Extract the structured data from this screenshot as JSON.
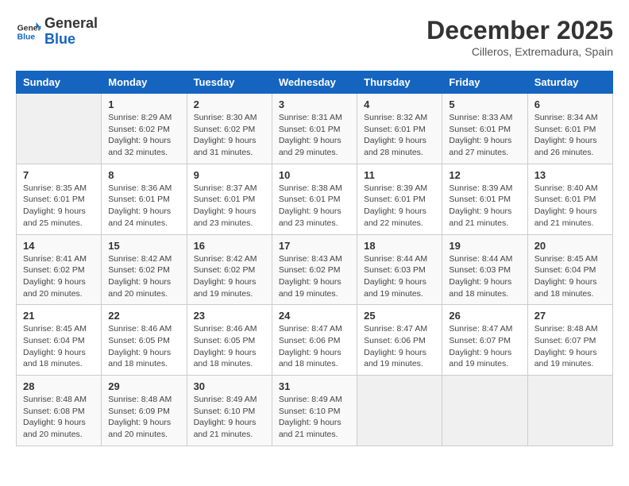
{
  "header": {
    "logo_general": "General",
    "logo_blue": "Blue",
    "month_title": "December 2025",
    "subtitle": "Cilleros, Extremadura, Spain"
  },
  "days_of_week": [
    "Sunday",
    "Monday",
    "Tuesday",
    "Wednesday",
    "Thursday",
    "Friday",
    "Saturday"
  ],
  "weeks": [
    [
      {
        "day": "",
        "info": ""
      },
      {
        "day": "1",
        "info": "Sunrise: 8:29 AM\nSunset: 6:02 PM\nDaylight: 9 hours\nand 32 minutes."
      },
      {
        "day": "2",
        "info": "Sunrise: 8:30 AM\nSunset: 6:02 PM\nDaylight: 9 hours\nand 31 minutes."
      },
      {
        "day": "3",
        "info": "Sunrise: 8:31 AM\nSunset: 6:01 PM\nDaylight: 9 hours\nand 29 minutes."
      },
      {
        "day": "4",
        "info": "Sunrise: 8:32 AM\nSunset: 6:01 PM\nDaylight: 9 hours\nand 28 minutes."
      },
      {
        "day": "5",
        "info": "Sunrise: 8:33 AM\nSunset: 6:01 PM\nDaylight: 9 hours\nand 27 minutes."
      },
      {
        "day": "6",
        "info": "Sunrise: 8:34 AM\nSunset: 6:01 PM\nDaylight: 9 hours\nand 26 minutes."
      }
    ],
    [
      {
        "day": "7",
        "info": "Sunrise: 8:35 AM\nSunset: 6:01 PM\nDaylight: 9 hours\nand 25 minutes."
      },
      {
        "day": "8",
        "info": "Sunrise: 8:36 AM\nSunset: 6:01 PM\nDaylight: 9 hours\nand 24 minutes."
      },
      {
        "day": "9",
        "info": "Sunrise: 8:37 AM\nSunset: 6:01 PM\nDaylight: 9 hours\nand 23 minutes."
      },
      {
        "day": "10",
        "info": "Sunrise: 8:38 AM\nSunset: 6:01 PM\nDaylight: 9 hours\nand 23 minutes."
      },
      {
        "day": "11",
        "info": "Sunrise: 8:39 AM\nSunset: 6:01 PM\nDaylight: 9 hours\nand 22 minutes."
      },
      {
        "day": "12",
        "info": "Sunrise: 8:39 AM\nSunset: 6:01 PM\nDaylight: 9 hours\nand 21 minutes."
      },
      {
        "day": "13",
        "info": "Sunrise: 8:40 AM\nSunset: 6:01 PM\nDaylight: 9 hours\nand 21 minutes."
      }
    ],
    [
      {
        "day": "14",
        "info": "Sunrise: 8:41 AM\nSunset: 6:02 PM\nDaylight: 9 hours\nand 20 minutes."
      },
      {
        "day": "15",
        "info": "Sunrise: 8:42 AM\nSunset: 6:02 PM\nDaylight: 9 hours\nand 20 minutes."
      },
      {
        "day": "16",
        "info": "Sunrise: 8:42 AM\nSunset: 6:02 PM\nDaylight: 9 hours\nand 19 minutes."
      },
      {
        "day": "17",
        "info": "Sunrise: 8:43 AM\nSunset: 6:02 PM\nDaylight: 9 hours\nand 19 minutes."
      },
      {
        "day": "18",
        "info": "Sunrise: 8:44 AM\nSunset: 6:03 PM\nDaylight: 9 hours\nand 19 minutes."
      },
      {
        "day": "19",
        "info": "Sunrise: 8:44 AM\nSunset: 6:03 PM\nDaylight: 9 hours\nand 18 minutes."
      },
      {
        "day": "20",
        "info": "Sunrise: 8:45 AM\nSunset: 6:04 PM\nDaylight: 9 hours\nand 18 minutes."
      }
    ],
    [
      {
        "day": "21",
        "info": "Sunrise: 8:45 AM\nSunset: 6:04 PM\nDaylight: 9 hours\nand 18 minutes."
      },
      {
        "day": "22",
        "info": "Sunrise: 8:46 AM\nSunset: 6:05 PM\nDaylight: 9 hours\nand 18 minutes."
      },
      {
        "day": "23",
        "info": "Sunrise: 8:46 AM\nSunset: 6:05 PM\nDaylight: 9 hours\nand 18 minutes."
      },
      {
        "day": "24",
        "info": "Sunrise: 8:47 AM\nSunset: 6:06 PM\nDaylight: 9 hours\nand 18 minutes."
      },
      {
        "day": "25",
        "info": "Sunrise: 8:47 AM\nSunset: 6:06 PM\nDaylight: 9 hours\nand 19 minutes."
      },
      {
        "day": "26",
        "info": "Sunrise: 8:47 AM\nSunset: 6:07 PM\nDaylight: 9 hours\nand 19 minutes."
      },
      {
        "day": "27",
        "info": "Sunrise: 8:48 AM\nSunset: 6:07 PM\nDaylight: 9 hours\nand 19 minutes."
      }
    ],
    [
      {
        "day": "28",
        "info": "Sunrise: 8:48 AM\nSunset: 6:08 PM\nDaylight: 9 hours\nand 20 minutes."
      },
      {
        "day": "29",
        "info": "Sunrise: 8:48 AM\nSunset: 6:09 PM\nDaylight: 9 hours\nand 20 minutes."
      },
      {
        "day": "30",
        "info": "Sunrise: 8:49 AM\nSunset: 6:10 PM\nDaylight: 9 hours\nand 21 minutes."
      },
      {
        "day": "31",
        "info": "Sunrise: 8:49 AM\nSunset: 6:10 PM\nDaylight: 9 hours\nand 21 minutes."
      },
      {
        "day": "",
        "info": ""
      },
      {
        "day": "",
        "info": ""
      },
      {
        "day": "",
        "info": ""
      }
    ]
  ]
}
